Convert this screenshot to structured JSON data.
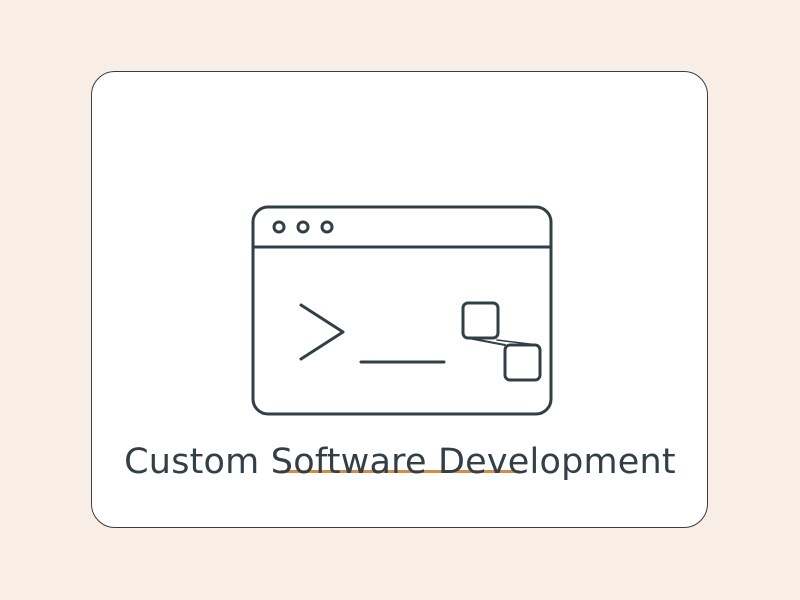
{
  "card": {
    "title": "Custom Software Development"
  },
  "icons": {
    "window": "browser-window-icon",
    "prompt": "terminal-prompt-icon",
    "nodes": "connected-nodes-icon"
  },
  "colors": {
    "background": "#f9eee5",
    "card": "#ffffff",
    "stroke": "#333f47",
    "accent": "#d58b47"
  }
}
